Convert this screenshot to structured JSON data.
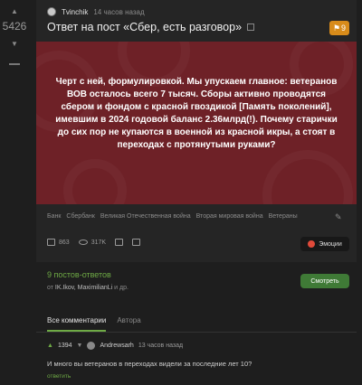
{
  "sidebar": {
    "rating": "5426"
  },
  "post": {
    "author": "Tvinchik",
    "time": "14 часов назад",
    "title": "Ответ на пост «Сбер, есть разговор»",
    "badge_count": "9",
    "text": "Черт с ней, формулировкой. Мы упускаем главное: ветеранов ВОВ осталось всего 7 тысяч. Сборы активно проводятся сбером и фондом с красной гвоздикой [Память поколений], имевшим в 2024 годовой баланс 2.36млрд(!). Почему старички до сих пор не купаются в военной из красной икры, а стоят в переходах с протянутыми руками?",
    "tags": [
      "Банк",
      "Сбербанк",
      "Великая Отечественная война",
      "Вторая мировая война",
      "Ветераны"
    ],
    "comments_count": "863",
    "views": "317K",
    "emotions_label": "Эмоции",
    "image_color": "#6e2127"
  },
  "replies": {
    "title": "9 постов-ответов",
    "from_prefix": "от",
    "from_users": "IK.Ikov, MaximilianLi",
    "from_suffix": "и др.",
    "show_label": "Смотреть"
  },
  "comments_tabs": [
    "Все комментарии",
    "Автора"
  ],
  "comment": {
    "score": "1394",
    "author": "Andrewsarh",
    "time": "13 часов назад",
    "body": "И много вы ветеранов в переходах видели за последние лет 10?",
    "reply": "ответить"
  },
  "colors": {
    "accent_green": "#6eaa45",
    "badge_orange": "#d88b1a",
    "button_green": "#3f7a36"
  }
}
